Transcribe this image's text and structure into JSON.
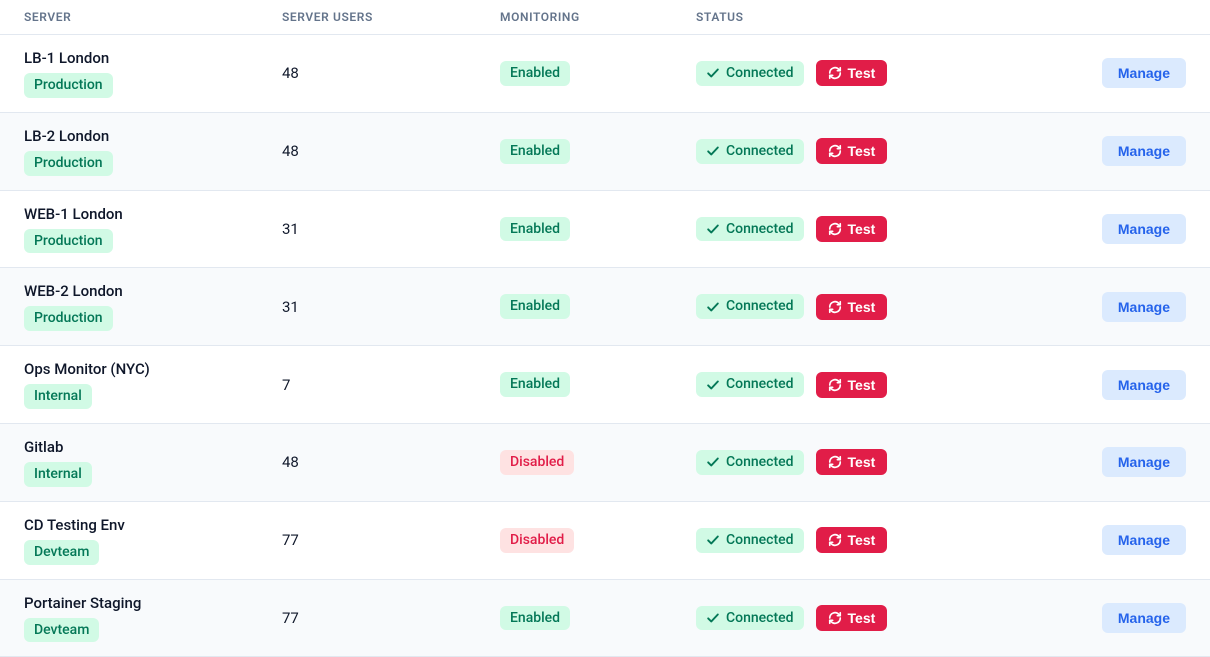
{
  "columns": {
    "server": "SERVER",
    "users": "SERVER USERS",
    "monitoring": "MONITORING",
    "status": "STATUS"
  },
  "labels": {
    "connected": "Connected",
    "test": "Test",
    "manage": "Manage",
    "enabled": "Enabled",
    "disabled": "Disabled"
  },
  "rows": [
    {
      "name": "LB-1 London",
      "env": "Production",
      "users": "48",
      "monitoring": "Enabled",
      "status": "Connected"
    },
    {
      "name": "LB-2 London",
      "env": "Production",
      "users": "48",
      "monitoring": "Enabled",
      "status": "Connected"
    },
    {
      "name": "WEB-1 London",
      "env": "Production",
      "users": "31",
      "monitoring": "Enabled",
      "status": "Connected"
    },
    {
      "name": "WEB-2 London",
      "env": "Production",
      "users": "31",
      "monitoring": "Enabled",
      "status": "Connected"
    },
    {
      "name": "Ops Monitor (NYC)",
      "env": "Internal",
      "users": "7",
      "monitoring": "Enabled",
      "status": "Connected"
    },
    {
      "name": "Gitlab",
      "env": "Internal",
      "users": "48",
      "monitoring": "Disabled",
      "status": "Connected"
    },
    {
      "name": "CD Testing Env",
      "env": "Devteam",
      "users": "77",
      "monitoring": "Disabled",
      "status": "Connected"
    },
    {
      "name": "Portainer Staging",
      "env": "Devteam",
      "users": "77",
      "monitoring": "Enabled",
      "status": "Connected"
    }
  ],
  "colors": {
    "badgeGreenBg": "#d1fae5",
    "badgeGreenFg": "#047857",
    "badgeRedBg": "#fee2e2",
    "badgeRedFg": "#e11d48",
    "testBg": "#e11d48",
    "manageBg": "#dbeafe",
    "manageFg": "#2563eb"
  }
}
